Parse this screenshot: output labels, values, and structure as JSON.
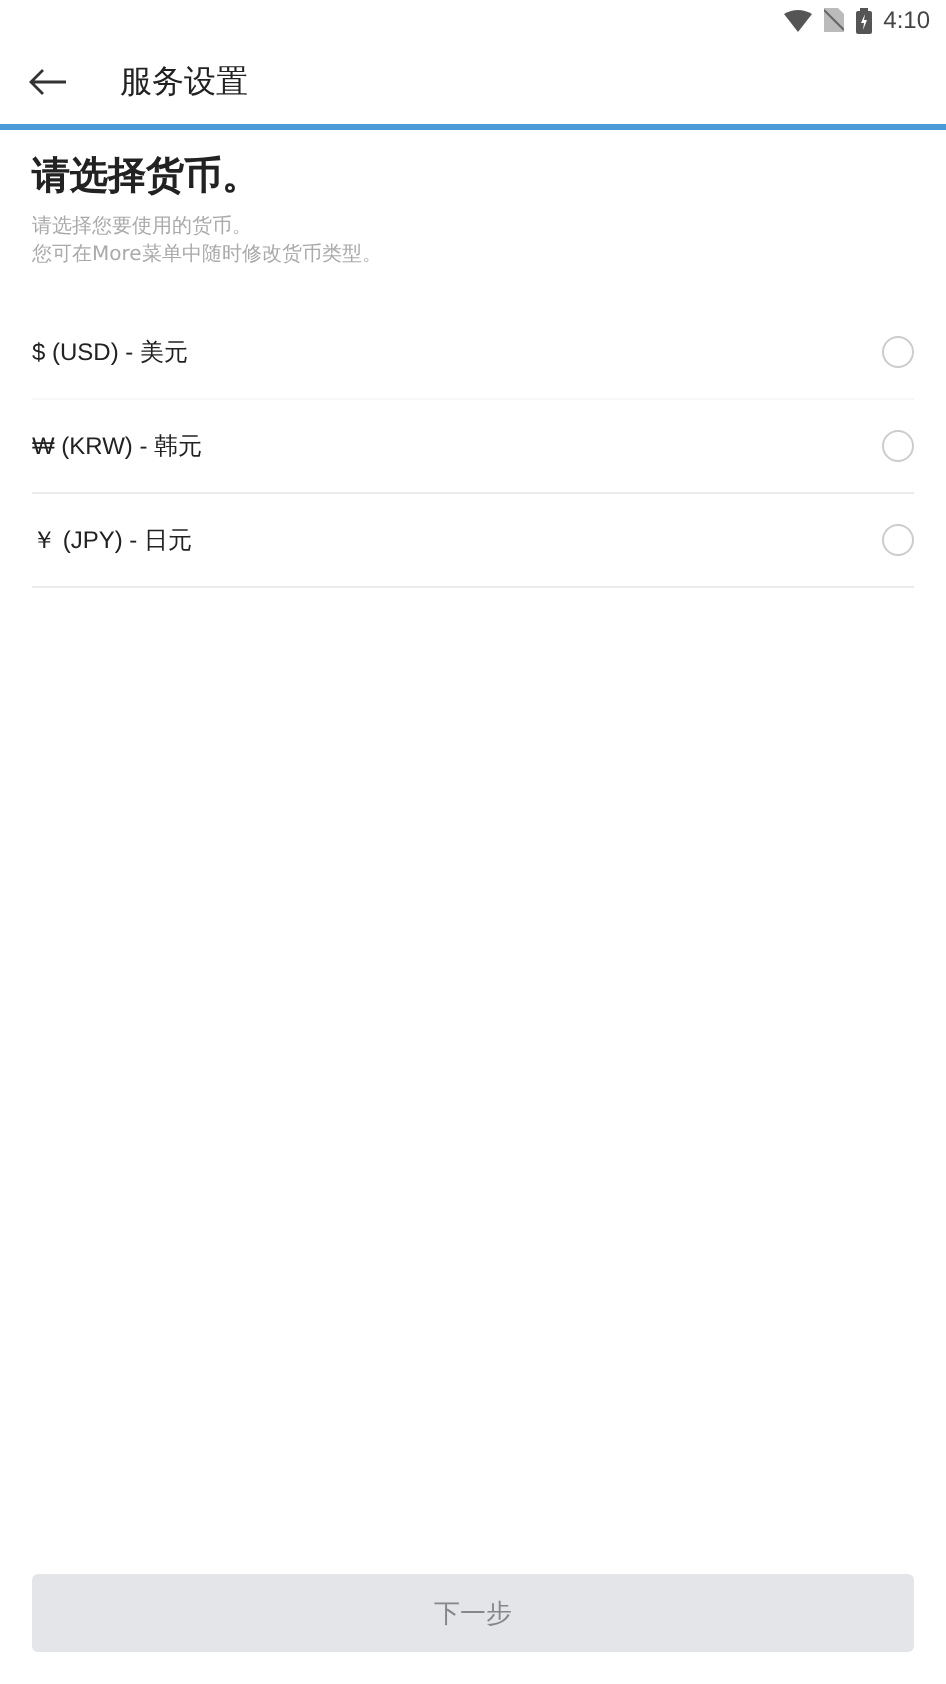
{
  "status_bar": {
    "time": "4:10"
  },
  "header": {
    "title": "服务设置"
  },
  "heading": "请选择货币。",
  "description": [
    "请选择您要使用的货币。",
    "您可在More菜单中随时修改货币类型。"
  ],
  "currencies": [
    {
      "label": "$ (USD) - 美元",
      "selected": false
    },
    {
      "label": "₩ (KRW) - 韩元",
      "selected": false
    },
    {
      "label": "￥ (JPY) - 日元",
      "selected": false
    }
  ],
  "next_button": {
    "label": "下一步",
    "disabled": true
  }
}
